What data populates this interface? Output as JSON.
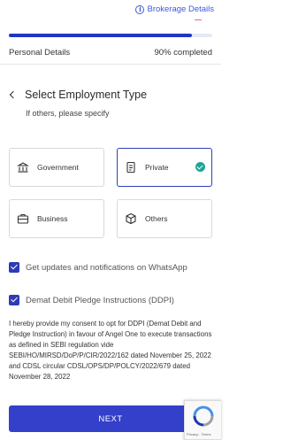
{
  "header": {
    "brokerage_label": "Brokerage Details",
    "info_icon": "info-icon"
  },
  "progress": {
    "step_label": "Personal Details",
    "percent_label": "90% completed",
    "value": 0.9
  },
  "page": {
    "title": "Select Employment Type",
    "subtitle": "If others, please specify"
  },
  "employment_options": [
    {
      "label": "Government",
      "icon": "government-building-icon",
      "selected": false
    },
    {
      "label": "Private",
      "icon": "private-document-icon",
      "selected": true
    },
    {
      "label": "Business",
      "icon": "briefcase-icon",
      "selected": false
    },
    {
      "label": "Others",
      "icon": "cube-icon",
      "selected": false
    }
  ],
  "options": {
    "whatsapp_label": "Get updates and notifications on WhatsApp",
    "whatsapp_checked": true,
    "ddpi_label": "Demat Debit Pledge Instructions (DDPI)",
    "ddpi_checked": true
  },
  "consent_text": "I hereby provide my consent to opt for DDPI (Demat Debit and Pledge Instruction) in favour of Angel One to execute transactions as defined in SEBI regulation vide SEBI/HO/MIRSD/DoP/P/CIR/2022/162 dated November 25, 2022 and CDSL circular CDSL/OPS/DP/POLCY/2022/679 dated November 28, 2022",
  "next_button": "NEXT",
  "recaptcha": {
    "links": "Privacy - Terms"
  },
  "colors": {
    "primary": "#3440c9",
    "progress": "#1f37c4",
    "link": "#3d5bd9",
    "check_badge": "#21a497"
  }
}
